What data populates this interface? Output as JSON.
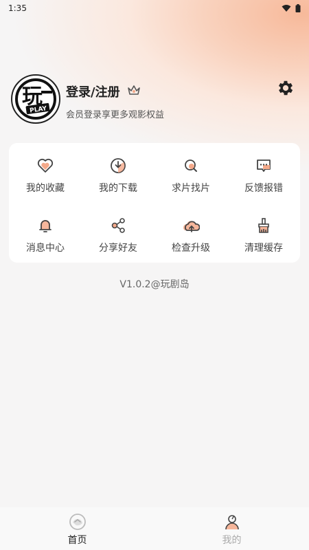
{
  "status_bar": {
    "time": "1:35",
    "icons": [
      "wifi-icon",
      "battery-icon"
    ]
  },
  "profile": {
    "avatar_text": "玩",
    "avatar_sub": "PLAY",
    "title": "登录/注册",
    "subtitle": "会员登录享更多观影权益",
    "vip_icon": "crown-icon",
    "settings_icon": "gear-icon"
  },
  "menu": [
    {
      "label": "我的收藏",
      "icon": "heart-icon"
    },
    {
      "label": "我的下载",
      "icon": "download-icon"
    },
    {
      "label": "求片找片",
      "icon": "search-icon"
    },
    {
      "label": "反馈报错",
      "icon": "feedback-icon"
    },
    {
      "label": "消息中心",
      "icon": "bell-icon"
    },
    {
      "label": "分享好友",
      "icon": "share-icon"
    },
    {
      "label": "检查升级",
      "icon": "cloud-upload-icon"
    },
    {
      "label": "清理缓存",
      "icon": "brush-icon"
    }
  ],
  "version": "V1.0.2@玩剧岛",
  "tabs": [
    {
      "label": "首页",
      "icon": "home-icon",
      "active": true
    },
    {
      "label": "我的",
      "icon": "profile-icon",
      "active": false
    }
  ],
  "colors": {
    "accent": "#f7b99a",
    "icon_fill": "#f4a98a",
    "text_dark": "#222222"
  }
}
